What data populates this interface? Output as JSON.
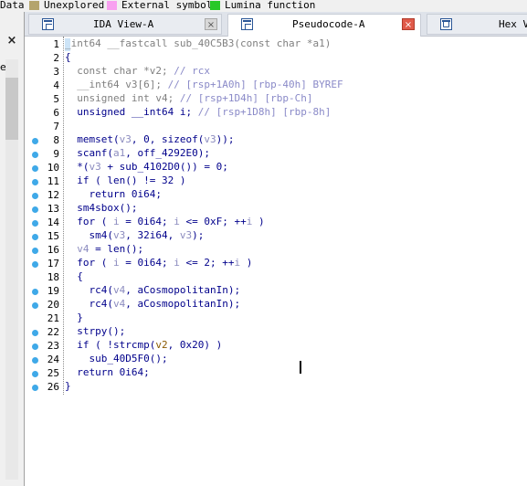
{
  "legend": [
    {
      "label": "Data",
      "color": null
    },
    {
      "label": "Unexplored",
      "color": "#b4a46c"
    },
    {
      "label": "External symbol",
      "color": "#f8a0f0"
    },
    {
      "label": "Lumina function",
      "color": "#28c828"
    }
  ],
  "left_panel": {
    "close_glyph": "×",
    "fragment_text": "e"
  },
  "tabs": [
    {
      "label": "IDA View-A",
      "icon": "ida-view-icon",
      "close": "×",
      "active": false
    },
    {
      "label": "Pseudocode-A",
      "icon": "pseudocode-icon",
      "close": "×",
      "active": true
    },
    {
      "label": "Hex V",
      "icon": "hex-view-icon",
      "active": false
    }
  ],
  "code": {
    "lines": [
      {
        "n": "1",
        "bp": false,
        "tokens": [
          {
            "t": "_int64 __fastcall sub_40C5B3(const char *a1)",
            "c": "g"
          }
        ]
      },
      {
        "n": "2",
        "bp": false,
        "tokens": [
          {
            "t": "{",
            "c": "p"
          }
        ]
      },
      {
        "n": "3",
        "bp": false,
        "tokens": [
          {
            "t": "  const char *v2; ",
            "c": "g"
          },
          {
            "t": "// rcx",
            "c": "c"
          }
        ]
      },
      {
        "n": "4",
        "bp": false,
        "tokens": [
          {
            "t": "  __int64 v3[6]; ",
            "c": "g"
          },
          {
            "t": "// [rsp+1A0h] [rbp-40h] BYREF",
            "c": "c"
          }
        ]
      },
      {
        "n": "5",
        "bp": false,
        "tokens": [
          {
            "t": "  unsigned int v4; ",
            "c": "g"
          },
          {
            "t": "// [rsp+1D4h] [rbp-Ch]",
            "c": "c"
          }
        ]
      },
      {
        "n": "6",
        "bp": false,
        "tokens": [
          {
            "t": "  unsigned __int64 i; ",
            "c": "k"
          },
          {
            "t": "// [rsp+1D8h] [rbp-8h]",
            "c": "c"
          }
        ]
      },
      {
        "n": "7",
        "bp": false,
        "tokens": [
          {
            "t": "",
            "c": "k"
          }
        ]
      },
      {
        "n": "8",
        "bp": true,
        "tokens": [
          {
            "t": "  memset(",
            "c": "k"
          },
          {
            "t": "v3",
            "c": "v"
          },
          {
            "t": ", 0, sizeof(",
            "c": "k"
          },
          {
            "t": "v3",
            "c": "v"
          },
          {
            "t": "));",
            "c": "k"
          }
        ]
      },
      {
        "n": "9",
        "bp": true,
        "tokens": [
          {
            "t": "  scanf(",
            "c": "k"
          },
          {
            "t": "a1",
            "c": "v"
          },
          {
            "t": ", off_4292E0);",
            "c": "k"
          }
        ]
      },
      {
        "n": "10",
        "bp": true,
        "tokens": [
          {
            "t": "  *(",
            "c": "k"
          },
          {
            "t": "v3",
            "c": "v"
          },
          {
            "t": " + sub_4102D0()) = 0;",
            "c": "k"
          }
        ]
      },
      {
        "n": "11",
        "bp": true,
        "tokens": [
          {
            "t": "  if ( len() != 32 )",
            "c": "k"
          }
        ]
      },
      {
        "n": "12",
        "bp": true,
        "tokens": [
          {
            "t": "    return 0i64;",
            "c": "k"
          }
        ]
      },
      {
        "n": "13",
        "bp": true,
        "tokens": [
          {
            "t": "  sm4sbox();",
            "c": "k"
          }
        ]
      },
      {
        "n": "14",
        "bp": true,
        "tokens": [
          {
            "t": "  for ( ",
            "c": "k"
          },
          {
            "t": "i",
            "c": "v"
          },
          {
            "t": " = 0i64; ",
            "c": "k"
          },
          {
            "t": "i",
            "c": "v"
          },
          {
            "t": " <= 0xF; ++",
            "c": "k"
          },
          {
            "t": "i",
            "c": "v"
          },
          {
            "t": " )",
            "c": "k"
          }
        ]
      },
      {
        "n": "15",
        "bp": true,
        "tokens": [
          {
            "t": "    sm4(",
            "c": "k"
          },
          {
            "t": "v3",
            "c": "v"
          },
          {
            "t": ", 32i64, ",
            "c": "k"
          },
          {
            "t": "v3",
            "c": "v"
          },
          {
            "t": ");",
            "c": "k"
          }
        ]
      },
      {
        "n": "16",
        "bp": true,
        "tokens": [
          {
            "t": "  ",
            "c": "k"
          },
          {
            "t": "v4",
            "c": "v"
          },
          {
            "t": " = len();",
            "c": "k"
          }
        ]
      },
      {
        "n": "17",
        "bp": true,
        "tokens": [
          {
            "t": "  for ( ",
            "c": "k"
          },
          {
            "t": "i",
            "c": "v"
          },
          {
            "t": " = 0i64; ",
            "c": "k"
          },
          {
            "t": "i",
            "c": "v"
          },
          {
            "t": " <= 2; ++",
            "c": "k"
          },
          {
            "t": "i",
            "c": "v"
          },
          {
            "t": " )",
            "c": "k"
          }
        ]
      },
      {
        "n": "18",
        "bp": false,
        "tokens": [
          {
            "t": "  {",
            "c": "k"
          }
        ]
      },
      {
        "n": "19",
        "bp": true,
        "tokens": [
          {
            "t": "    rc4(",
            "c": "k"
          },
          {
            "t": "v4",
            "c": "v"
          },
          {
            "t": ", aCosmopolitanIn);",
            "c": "k"
          }
        ]
      },
      {
        "n": "20",
        "bp": true,
        "tokens": [
          {
            "t": "    rc4(",
            "c": "k"
          },
          {
            "t": "v4",
            "c": "v"
          },
          {
            "t": ", aCosmopolitanIn);",
            "c": "k"
          }
        ]
      },
      {
        "n": "21",
        "bp": false,
        "tokens": [
          {
            "t": "  }",
            "c": "k"
          }
        ]
      },
      {
        "n": "22",
        "bp": true,
        "tokens": [
          {
            "t": "  strpy();",
            "c": "k"
          }
        ]
      },
      {
        "n": "23",
        "bp": true,
        "tokens": [
          {
            "t": "  if ( !strcmp(",
            "c": "k"
          },
          {
            "t": "v2",
            "c": "s"
          },
          {
            "t": ", 0x20) )",
            "c": "k"
          }
        ]
      },
      {
        "n": "24",
        "bp": true,
        "tokens": [
          {
            "t": "    sub_40D5F0();",
            "c": "k"
          }
        ]
      },
      {
        "n": "25",
        "bp": true,
        "tokens": [
          {
            "t": "  return 0i64;",
            "c": "k"
          }
        ]
      },
      {
        "n": "26",
        "bp": true,
        "tokens": [
          {
            "t": "}",
            "c": "k"
          }
        ]
      }
    ]
  }
}
